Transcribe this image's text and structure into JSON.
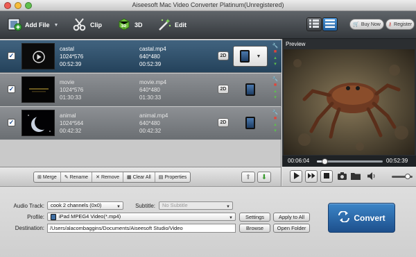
{
  "window": {
    "title": "Aiseesoft Mac Video Converter Platinum(Unregistered)"
  },
  "toolbar": {
    "add_file": "Add File",
    "clip": "Clip",
    "threed": "3D",
    "edit": "Edit",
    "buy_now": "Buy Now",
    "register": "Register"
  },
  "files": [
    {
      "name": "castal",
      "resolution": "1024*576",
      "duration": "00:52:39",
      "out_name": "castal.mp4",
      "out_resolution": "640*480",
      "out_duration": "00:52:39",
      "mode": "2D",
      "checked": "✓"
    },
    {
      "name": "movie",
      "resolution": "1024*576",
      "duration": "01:30:33",
      "out_name": "movie.mp4",
      "out_resolution": "640*480",
      "out_duration": "01:30:33",
      "mode": "2D",
      "checked": "✓"
    },
    {
      "name": "animal",
      "resolution": "1024*564",
      "duration": "00:42:32",
      "out_name": "animal.mp4",
      "out_resolution": "640*480",
      "out_duration": "00:42:32",
      "mode": "2D",
      "checked": "✓"
    }
  ],
  "actions": {
    "merge": "Merge",
    "rename": "Rename",
    "remove": "Remove",
    "clear_all": "Clear All",
    "properties": "Properties"
  },
  "preview": {
    "label": "Preview",
    "current_time": "00:06:04",
    "total_time": "00:52:39",
    "progress": 0.115,
    "volume": 0.75
  },
  "settings": {
    "audio_track_label": "Audio Track:",
    "audio_track_value": "cook 2 channels (0x0)",
    "subtitle_label": "Subtitle:",
    "subtitle_value": "No Subtitle",
    "profile_label": "Profile:",
    "profile_value": "iPad MPEG4 Video(*.mp4)",
    "settings_button": "Settings",
    "apply_all_button": "Apply to All",
    "destination_label": "Destination:",
    "destination_value": "/Users/alacombaggins/Documents/Aiseesoft Studio/Video",
    "browse_button": "Browse",
    "open_folder_button": "Open Folder",
    "convert_button": "Convert"
  },
  "colors": {
    "selected_row": "#2f5170",
    "unselected_row": "#7c8084",
    "convert_button": "#2a67a8",
    "toolbar": "#45494d"
  }
}
